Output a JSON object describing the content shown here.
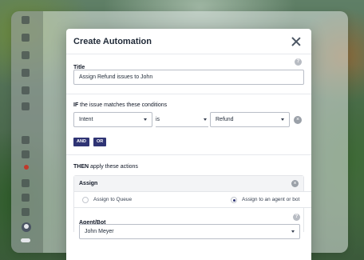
{
  "modal": {
    "title": "Create Automation",
    "title_field": {
      "label": "Title",
      "value": "Assign Refund issues to John"
    },
    "conditions": {
      "label_bold": "IF",
      "label_rest": " the issue matches these conditions",
      "field": "Intent",
      "operator": "is",
      "value": "Refund",
      "and_label": "AND",
      "or_label": "OR"
    },
    "actions": {
      "label_bold": "THEN",
      "label_rest": " apply these actions",
      "assign": {
        "label": "Assign",
        "options": [
          "Assign to Queue",
          "Assign to an agent or bot"
        ],
        "selected_index": 1
      },
      "agent_bot": {
        "label": "Agent/Bot",
        "value": "John Meyer"
      }
    }
  },
  "icons": {
    "help": "?",
    "remove": "×"
  },
  "colors": {
    "accent": "#2f3474",
    "border": "#b9bec7"
  }
}
